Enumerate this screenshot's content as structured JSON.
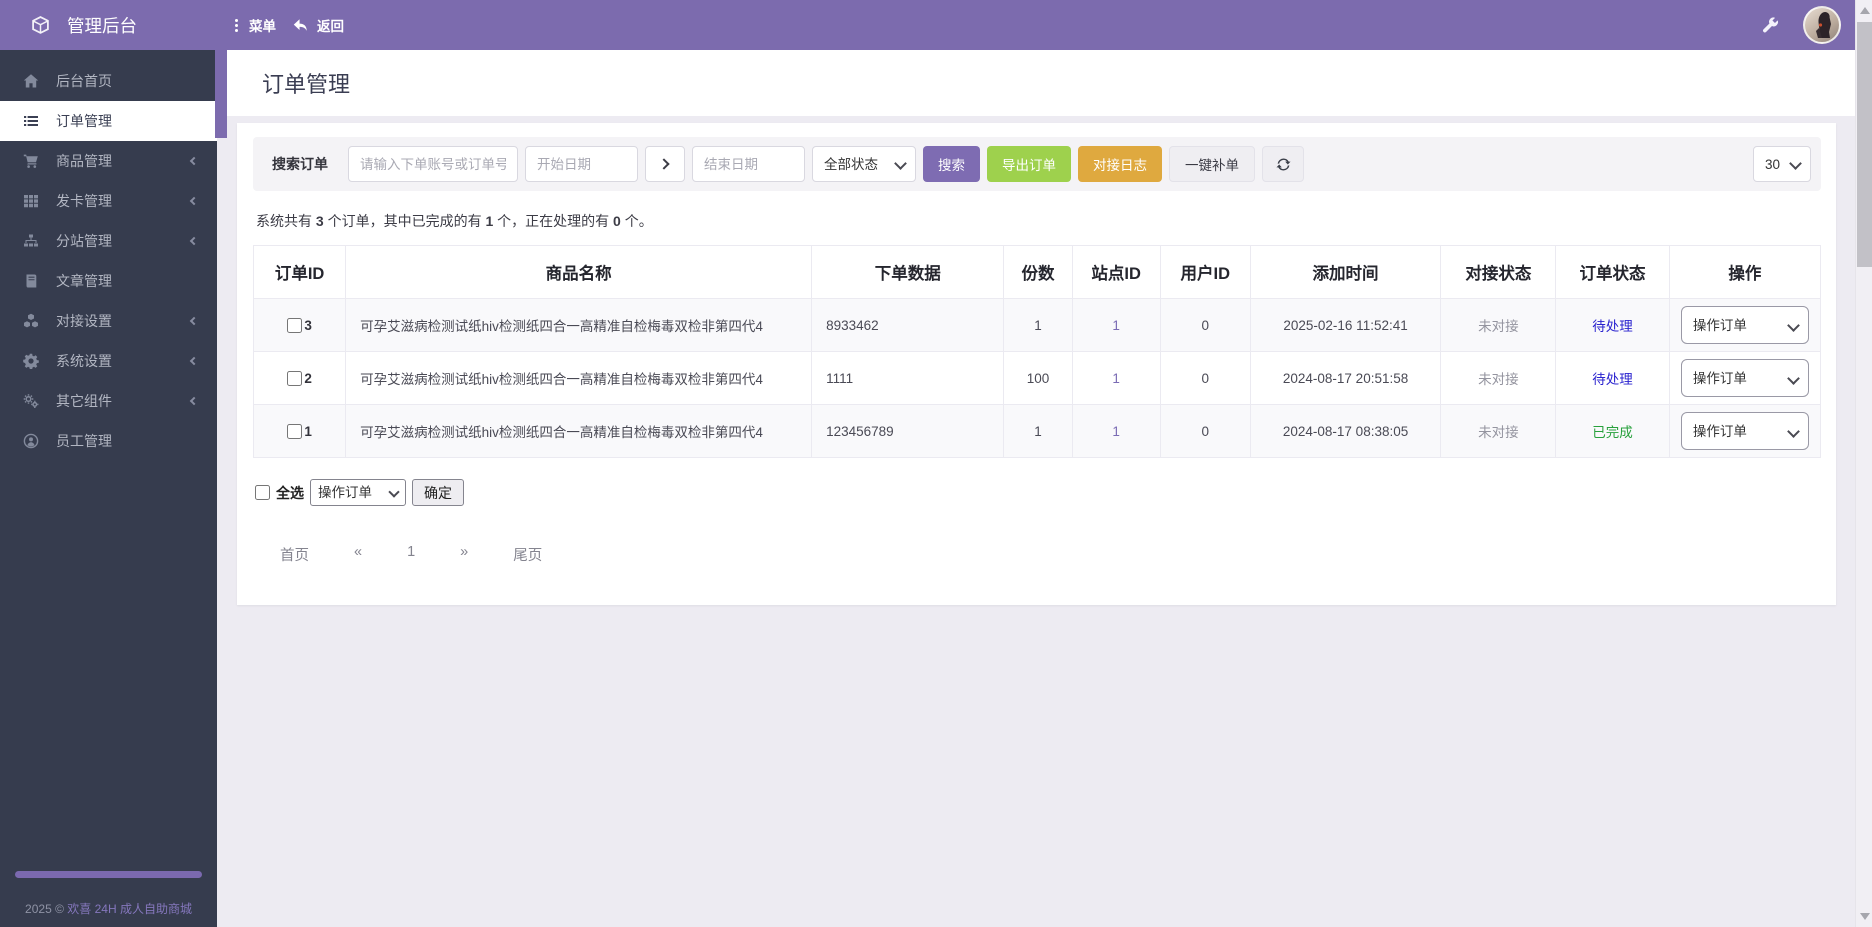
{
  "topbar": {
    "title": "管理后台",
    "menu": "菜单",
    "back": "返回"
  },
  "sidebar": {
    "items": [
      {
        "label": "后台首页",
        "icon": "home-icon",
        "active": false,
        "expandable": false
      },
      {
        "label": "订单管理",
        "icon": "orders-list-icon",
        "active": true,
        "expandable": false
      },
      {
        "label": "商品管理",
        "icon": "products-cart-icon",
        "active": false,
        "expandable": true
      },
      {
        "label": "发卡管理",
        "icon": "cards-grid-icon",
        "active": false,
        "expandable": true
      },
      {
        "label": "分站管理",
        "icon": "substation-sitemap-icon",
        "active": false,
        "expandable": true
      },
      {
        "label": "文章管理",
        "icon": "articles-book-icon",
        "active": false,
        "expandable": false
      },
      {
        "label": "对接设置",
        "icon": "integration-cubes-icon",
        "active": false,
        "expandable": true
      },
      {
        "label": "系统设置",
        "icon": "system-gear-icon",
        "active": false,
        "expandable": true
      },
      {
        "label": "其它组件",
        "icon": "components-cogs-icon",
        "active": false,
        "expandable": true
      },
      {
        "label": "员工管理",
        "icon": "staff-user-icon",
        "active": false,
        "expandable": false
      }
    ],
    "footer_year": "2025 © ",
    "footer_site": "欢喜 24H 成人自助商城"
  },
  "page": {
    "title": "订单管理"
  },
  "toolbar": {
    "search_label": "搜索订单",
    "account_placeholder": "请输入下单账号或订单号",
    "start_date_placeholder": "开始日期",
    "end_date_placeholder": "结束日期",
    "status_filter": "全部状态",
    "search_btn": "搜索",
    "export_btn": "导出订单",
    "log_btn": "对接日志",
    "reissue_btn": "一键补单",
    "page_size": "30"
  },
  "summary": {
    "s0": "系统共有 ",
    "n1": "3",
    "s1": " 个订单，其中已完成的有 ",
    "n2": "1",
    "s2": " 个，正在处理的有 ",
    "n3": "0",
    "s3": " 个。"
  },
  "table": {
    "headers": [
      "订单ID",
      "商品名称",
      "下单数据",
      "份数",
      "站点ID",
      "用户ID",
      "添加时间",
      "对接状态",
      "订单状态",
      "操作"
    ],
    "rows": [
      {
        "id": "3",
        "product": "可孕艾滋病检测试纸hiv检测纸四合一高精准自检梅毒双检非第四代4",
        "order_data": "8933462",
        "qty": "1",
        "site_id": "1",
        "user_id": "0",
        "added_time": "2025-02-16 11:52:41",
        "link_status": "未对接",
        "status": "待处理",
        "action": "操作订单"
      },
      {
        "id": "2",
        "product": "可孕艾滋病检测试纸hiv检测纸四合一高精准自检梅毒双检非第四代4",
        "order_data": "1111",
        "qty": "100",
        "site_id": "1",
        "user_id": "0",
        "added_time": "2024-08-17 20:51:58",
        "link_status": "未对接",
        "status": "待处理",
        "action": "操作订单"
      },
      {
        "id": "1",
        "product": "可孕艾滋病检测试纸hiv检测纸四合一高精准自检梅毒双检非第四代4",
        "order_data": "123456789",
        "qty": "1",
        "site_id": "1",
        "user_id": "0",
        "added_time": "2024-08-17 08:38:05",
        "link_status": "未对接",
        "status": "已完成",
        "action": "操作订单"
      }
    ]
  },
  "bulk": {
    "select_all": "全选",
    "action": "操作订单",
    "confirm": "确定"
  },
  "pagination": {
    "first": "首页",
    "prev": "«",
    "page": "1",
    "next": "»",
    "last": "尾页"
  },
  "colors": {
    "brand_purple": "#7c6bae",
    "sidebar_bg": "#363c4e",
    "export_green": "#9ed14d",
    "log_orange": "#dfa93f",
    "status_pending_blue": "#2a23cf",
    "status_done_green": "#28a13c",
    "status_muted_gray": "#94949f"
  }
}
